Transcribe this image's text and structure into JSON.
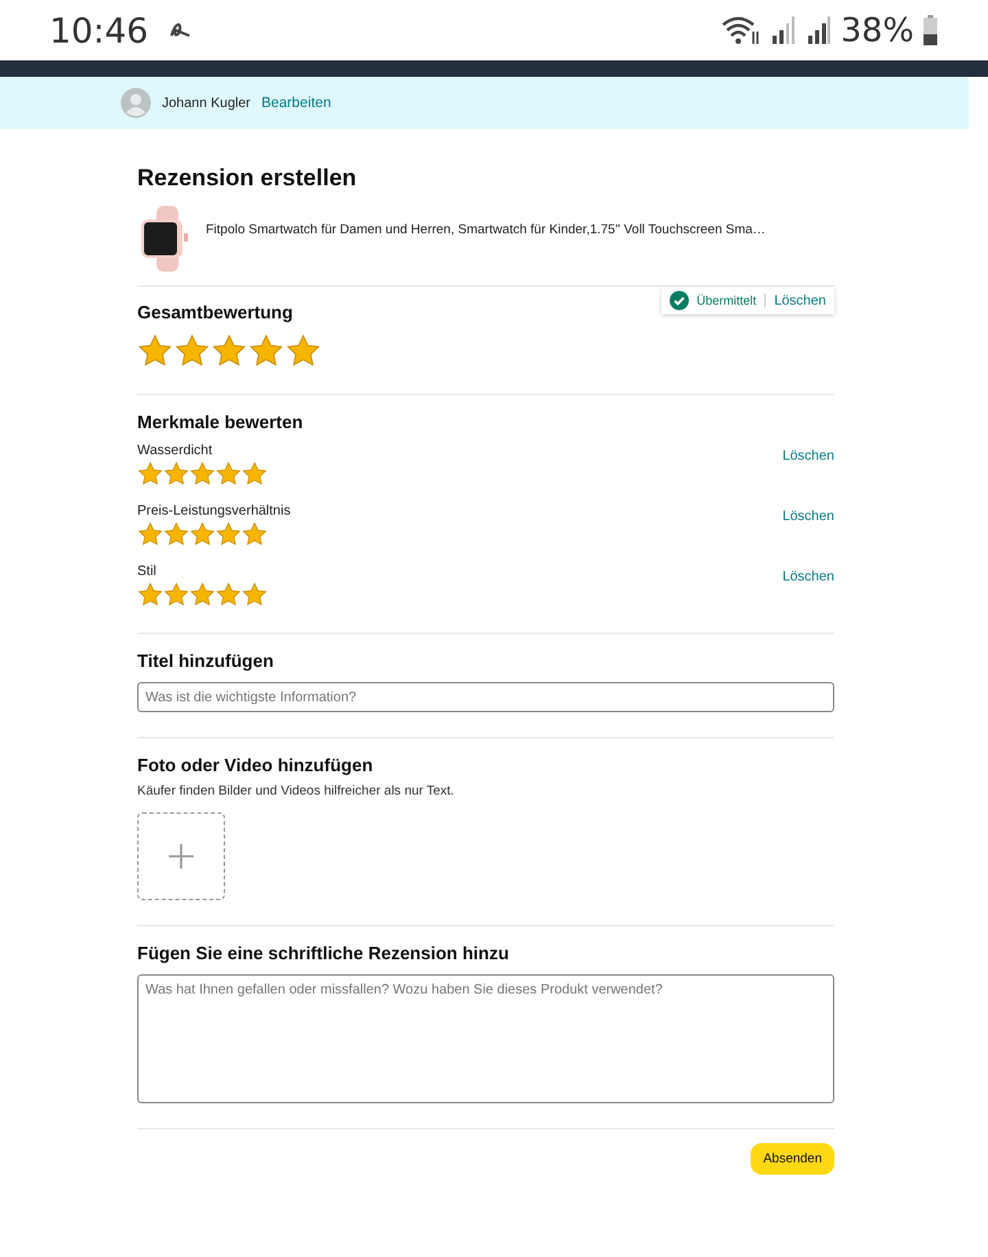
{
  "status_bar": {
    "time": "10:46",
    "battery": "38%"
  },
  "user": {
    "name": "Johann Kugler",
    "edit_link": "Bearbeiten"
  },
  "page_title": "Rezension erstellen",
  "product": {
    "title": "Fitpolo Smartwatch für Damen und Herren, Smartwatch für Kinder,1.75'' Voll Touchscreen Sma…"
  },
  "overall": {
    "heading": "Gesamtbewertung",
    "stars": 5,
    "status": "Übermittelt",
    "delete": "Löschen"
  },
  "features": {
    "heading": "Merkmale bewerten",
    "items": [
      {
        "name": "Wasserdicht",
        "stars": 5,
        "delete": "Löschen"
      },
      {
        "name": "Preis-Leistungsverhältnis",
        "stars": 5,
        "delete": "Löschen"
      },
      {
        "name": "Stil",
        "stars": 5,
        "delete": "Löschen"
      }
    ]
  },
  "title_section": {
    "heading": "Titel hinzufügen",
    "placeholder": "Was ist die wichtigste Information?"
  },
  "media": {
    "heading": "Foto oder Video hinzufügen",
    "hint": "Käufer finden Bilder und Videos hilfreicher als nur Text."
  },
  "review": {
    "heading": "Fügen Sie eine schriftliche Rezension hinzu",
    "placeholder": "Was hat Ihnen gefallen oder missfallen? Wozu haben Sie dieses Produkt verwendet?"
  },
  "submit": "Absenden"
}
